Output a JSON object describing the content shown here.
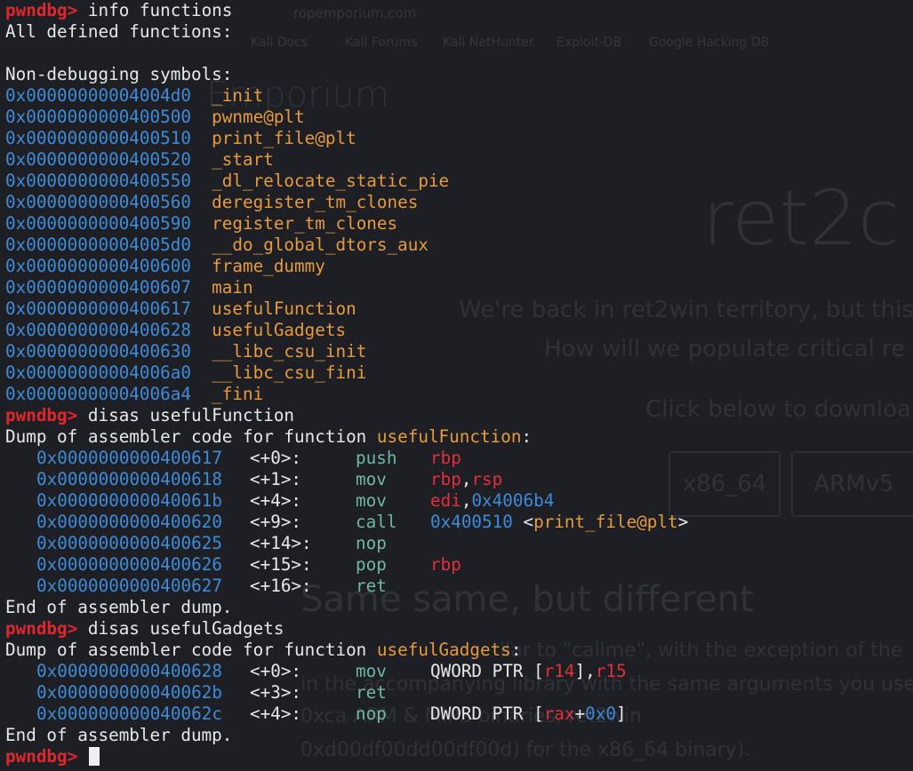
{
  "background": {
    "url": "ropemporium.com",
    "bookmarks": [
      "Kali Docs",
      "Kali Forums",
      "Kali NetHunter",
      "Exploit-DB",
      "Google Hacking DB"
    ],
    "site_title": "Emporium",
    "challenge_title": "ret2c",
    "intro_1": "We're back in ret2win territory, but this",
    "intro_2": "How will we populate critical re",
    "download_text": "Click below to downloa",
    "buttons": [
      "x86_64",
      "ARMv5"
    ],
    "section_title": "Same same, but different",
    "para_1": "ilar to \"callme\", with the exception of the",
    "para_2": "in the accompanying library with the same arguments you used to",
    "para_3": "0xca             ARM & MIPS binaries, ret2win",
    "para_4": "0xd00df00dd00df00d) for the x86_64 binary)."
  },
  "terminal": {
    "prompt": "pwndbg>",
    "cmd1": "info functions",
    "all_defined": "All defined functions:",
    "non_debug": "Non-debugging symbols:",
    "functions": [
      {
        "addr": "0x00000000004004d0",
        "name": "_init"
      },
      {
        "addr": "0x0000000000400500",
        "name": "pwnme@plt"
      },
      {
        "addr": "0x0000000000400510",
        "name": "print_file@plt"
      },
      {
        "addr": "0x0000000000400520",
        "name": "_start"
      },
      {
        "addr": "0x0000000000400550",
        "name": "_dl_relocate_static_pie"
      },
      {
        "addr": "0x0000000000400560",
        "name": "deregister_tm_clones"
      },
      {
        "addr": "0x0000000000400590",
        "name": "register_tm_clones"
      },
      {
        "addr": "0x00000000004005d0",
        "name": "__do_global_dtors_aux"
      },
      {
        "addr": "0x0000000000400600",
        "name": "frame_dummy"
      },
      {
        "addr": "0x0000000000400607",
        "name": "main"
      },
      {
        "addr": "0x0000000000400617",
        "name": "usefulFunction"
      },
      {
        "addr": "0x0000000000400628",
        "name": "usefulGadgets"
      },
      {
        "addr": "0x0000000000400630",
        "name": "__libc_csu_init"
      },
      {
        "addr": "0x00000000004006a0",
        "name": "__libc_csu_fini"
      },
      {
        "addr": "0x00000000004006a4",
        "name": "_fini"
      }
    ],
    "cmd2": "disas usefulFunction",
    "dump_prefix": "Dump of assembler code for function ",
    "dump_suffix": ":",
    "func1": "usefulFunction",
    "func1_lines": [
      {
        "addr": "0x0000000000400617",
        "off": "<+0>:",
        "mn": "push",
        "ops": [
          {
            "t": "reg",
            "v": "rbp"
          }
        ]
      },
      {
        "addr": "0x0000000000400618",
        "off": "<+1>:",
        "mn": "mov",
        "ops": [
          {
            "t": "reg",
            "v": "rbp"
          },
          {
            "t": "txt",
            "v": ","
          },
          {
            "t": "reg",
            "v": "rsp"
          }
        ]
      },
      {
        "addr": "0x000000000040061b",
        "off": "<+4>:",
        "mn": "mov",
        "ops": [
          {
            "t": "reg",
            "v": "edi"
          },
          {
            "t": "txt",
            "v": ","
          },
          {
            "t": "num",
            "v": "0x4006b4"
          }
        ]
      },
      {
        "addr": "0x0000000000400620",
        "off": "<+9>:",
        "mn": "call",
        "ops": [
          {
            "t": "num",
            "v": "0x400510"
          },
          {
            "t": "txt",
            "v": " <"
          },
          {
            "t": "sym",
            "v": "print_file@plt"
          },
          {
            "t": "txt",
            "v": ">"
          }
        ]
      },
      {
        "addr": "0x0000000000400625",
        "off": "<+14>:",
        "mn": "nop",
        "ops": []
      },
      {
        "addr": "0x0000000000400626",
        "off": "<+15>:",
        "mn": "pop",
        "ops": [
          {
            "t": "reg",
            "v": "rbp"
          }
        ]
      },
      {
        "addr": "0x0000000000400627",
        "off": "<+16>:",
        "mn": "ret",
        "ops": []
      }
    ],
    "end_dump": "End of assembler dump.",
    "cmd3": "disas usefulGadgets",
    "func2": "usefulGadgets",
    "func2_lines": [
      {
        "addr": "0x0000000000400628",
        "off": "<+0>:",
        "mn": "mov",
        "ops": [
          {
            "t": "txt",
            "v": "QWORD PTR ["
          },
          {
            "t": "reg",
            "v": "r14"
          },
          {
            "t": "txt",
            "v": "],"
          },
          {
            "t": "reg",
            "v": "r15"
          }
        ]
      },
      {
        "addr": "0x000000000040062b",
        "off": "<+3>:",
        "mn": "ret",
        "ops": []
      },
      {
        "addr": "0x000000000040062c",
        "off": "<+4>:",
        "mn": "nop",
        "ops": [
          {
            "t": "txt",
            "v": "DWORD PTR ["
          },
          {
            "t": "reg",
            "v": "rax"
          },
          {
            "t": "txt",
            "v": "+"
          },
          {
            "t": "num",
            "v": "0x0"
          },
          {
            "t": "txt",
            "v": "]"
          }
        ]
      }
    ]
  }
}
